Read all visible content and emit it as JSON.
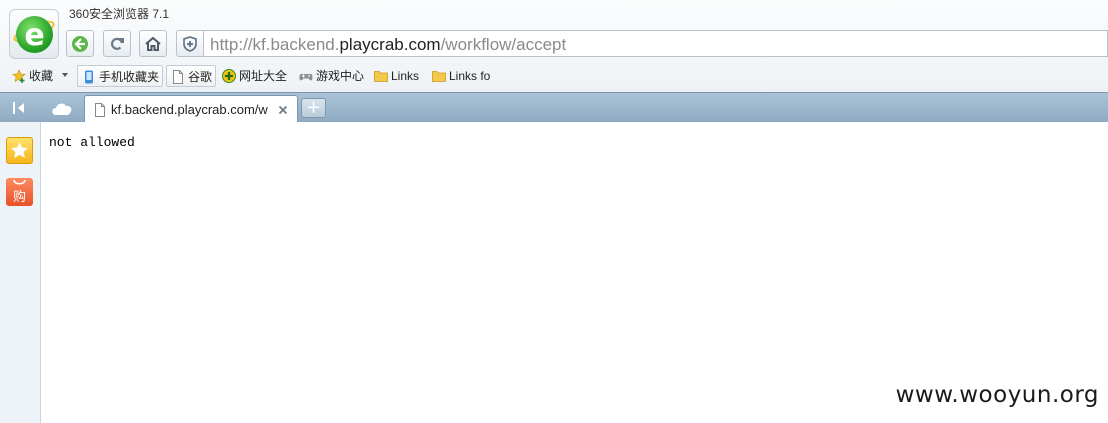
{
  "window": {
    "title": "360安全浏览器 7.1"
  },
  "toolbar": {
    "url_prefix": "http://kf.backend.",
    "url_domain": "playcrab.com",
    "url_path": "/workflow/accept"
  },
  "bookmarks": [
    {
      "label": "收藏",
      "icon": "star-plus-icon"
    },
    {
      "label": "手机收藏夹",
      "icon": "phone-icon"
    },
    {
      "label": "谷歌",
      "icon": "page-icon"
    },
    {
      "label": "网址大全",
      "icon": "plus-circle-icon"
    },
    {
      "label": "游戏中心",
      "icon": "gamepad-icon"
    },
    {
      "label": "Links",
      "icon": "folder-icon"
    },
    {
      "label": "Links fo",
      "icon": "folder-icon"
    }
  ],
  "tabs": [
    {
      "title": "kf.backend.playcrab.com/w",
      "active": true
    }
  ],
  "sidebar": {
    "shop_label": "购"
  },
  "page": {
    "body_text": "not allowed"
  },
  "watermark": "www.wooyun.org",
  "colors": {
    "tab_strip": "#9db8cc",
    "logo_green": "#1f9a22",
    "folder_yellow": "#f3c84b"
  }
}
